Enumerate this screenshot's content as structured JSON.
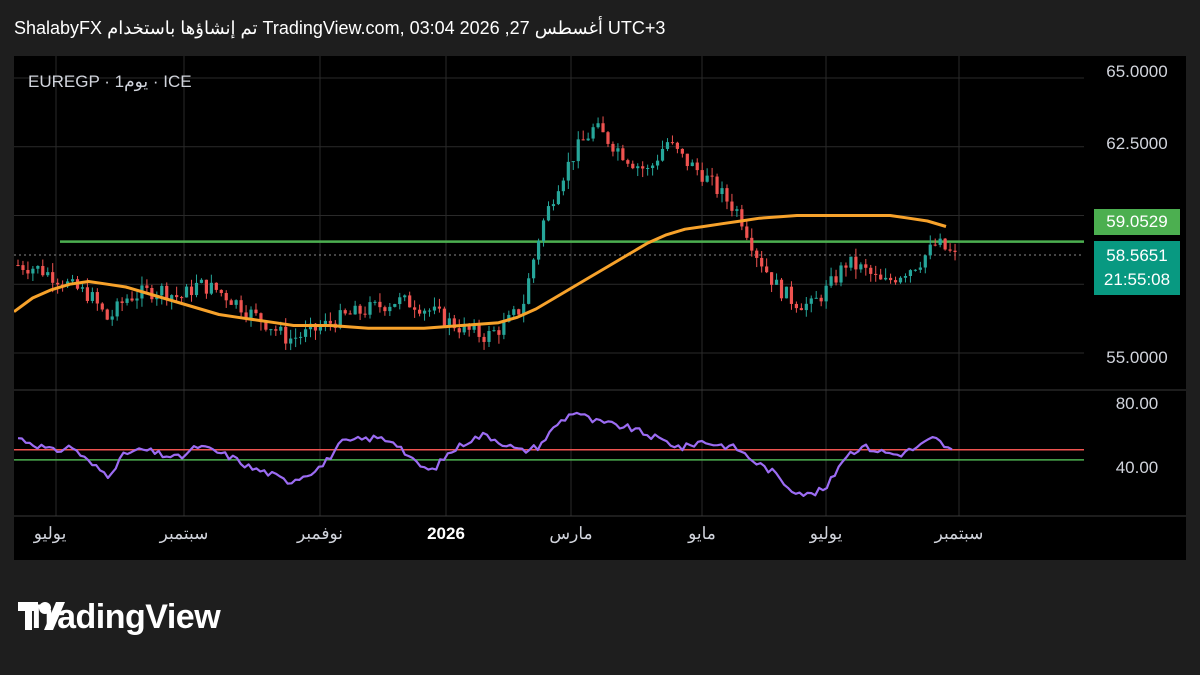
{
  "header": {
    "text": "ShalabyFX تم إنشاؤها باستخدام TradingView.com, 03:04 2026 ,27 أغسطس UTC+3"
  },
  "symbol_label": "EUREGP · 1يوم · ICE",
  "price_tags": {
    "green": "59.0529",
    "current": "58.5651",
    "countdown": "21:55:08"
  },
  "logo": {
    "text": "TradingView"
  },
  "colors": {
    "up": "#26a69a",
    "down": "#ef5350",
    "ma": "#f7a22b",
    "hline_green": "#4caf50",
    "rsi": "#9c6cf3",
    "rsi_upper": "#ef5350",
    "rsi_lower": "#4caf50"
  },
  "chart_data": [
    {
      "type": "line",
      "title": "EUREGP · 1يوم · ICE",
      "x": [
        "يوليو",
        "سبتمبر",
        "نوفمبر",
        "2026",
        "مارس",
        "مايو",
        "يوليو",
        "سبتمبر"
      ],
      "xlabels_bold": [
        "2026"
      ],
      "ylim": [
        53.8,
        65.8
      ],
      "yticks": [
        "65.0000",
        "62.5000",
        "55.0000"
      ],
      "series": [
        {
          "kind": "candle_close",
          "values": [
            58.2,
            58.1,
            57.8,
            57.4,
            57.1,
            56.2,
            57.0,
            57.2,
            57.3,
            57.0,
            57.5,
            57.3,
            56.9,
            56.4,
            56.0,
            55.5,
            55.7,
            56.0,
            56.3,
            56.5,
            56.7,
            56.9,
            56.8,
            56.5,
            56.1,
            55.8,
            55.6,
            56.0,
            56.7,
            59.5,
            61.2,
            62.4,
            63.2,
            62.6,
            62.0,
            61.6,
            62.7,
            62.0,
            61.5,
            60.8,
            60.1,
            58.6,
            57.5,
            56.9,
            56.7,
            57.4,
            58.3,
            58.0,
            57.5,
            57.9,
            58.3,
            59.0,
            58.5
          ]
        },
        {
          "kind": "moving_average",
          "values": [
            56.5,
            57.0,
            57.3,
            57.5,
            57.6,
            57.5,
            57.4,
            57.2,
            57.0,
            56.8,
            56.6,
            56.4,
            56.3,
            56.2,
            56.1,
            56.0,
            56.0,
            56.0,
            55.95,
            55.9,
            55.9,
            55.9,
            55.9,
            55.95,
            56.0,
            56.05,
            56.1,
            56.3,
            56.6,
            57.0,
            57.4,
            57.8,
            58.2,
            58.6,
            59.0,
            59.3,
            59.5,
            59.6,
            59.7,
            59.8,
            59.9,
            59.95,
            60.0,
            60.0,
            60.0,
            60.0,
            60.0,
            60.0,
            59.9,
            59.8,
            59.6
          ]
        }
      ],
      "hlines": [
        59.05
      ],
      "last_value": 58.5651
    },
    {
      "type": "line",
      "title": "",
      "ylim": [
        22,
        86
      ],
      "yticks": [
        "80.00",
        "40.00"
      ],
      "hlines": [
        53,
        47
      ],
      "series": [
        {
          "kind": "rsi",
          "values": [
            60,
            56,
            52,
            55,
            45,
            38,
            51,
            53,
            50,
            48,
            55,
            52,
            48,
            42,
            39,
            34,
            38,
            44,
            57,
            59,
            60,
            58,
            46,
            40,
            51,
            58,
            62,
            57,
            52,
            55,
            68,
            76,
            70,
            68,
            66,
            62,
            58,
            54,
            58,
            56,
            54,
            46,
            40,
            30,
            26,
            30,
            49,
            55,
            52,
            50,
            54,
            60,
            52
          ]
        }
      ]
    }
  ]
}
